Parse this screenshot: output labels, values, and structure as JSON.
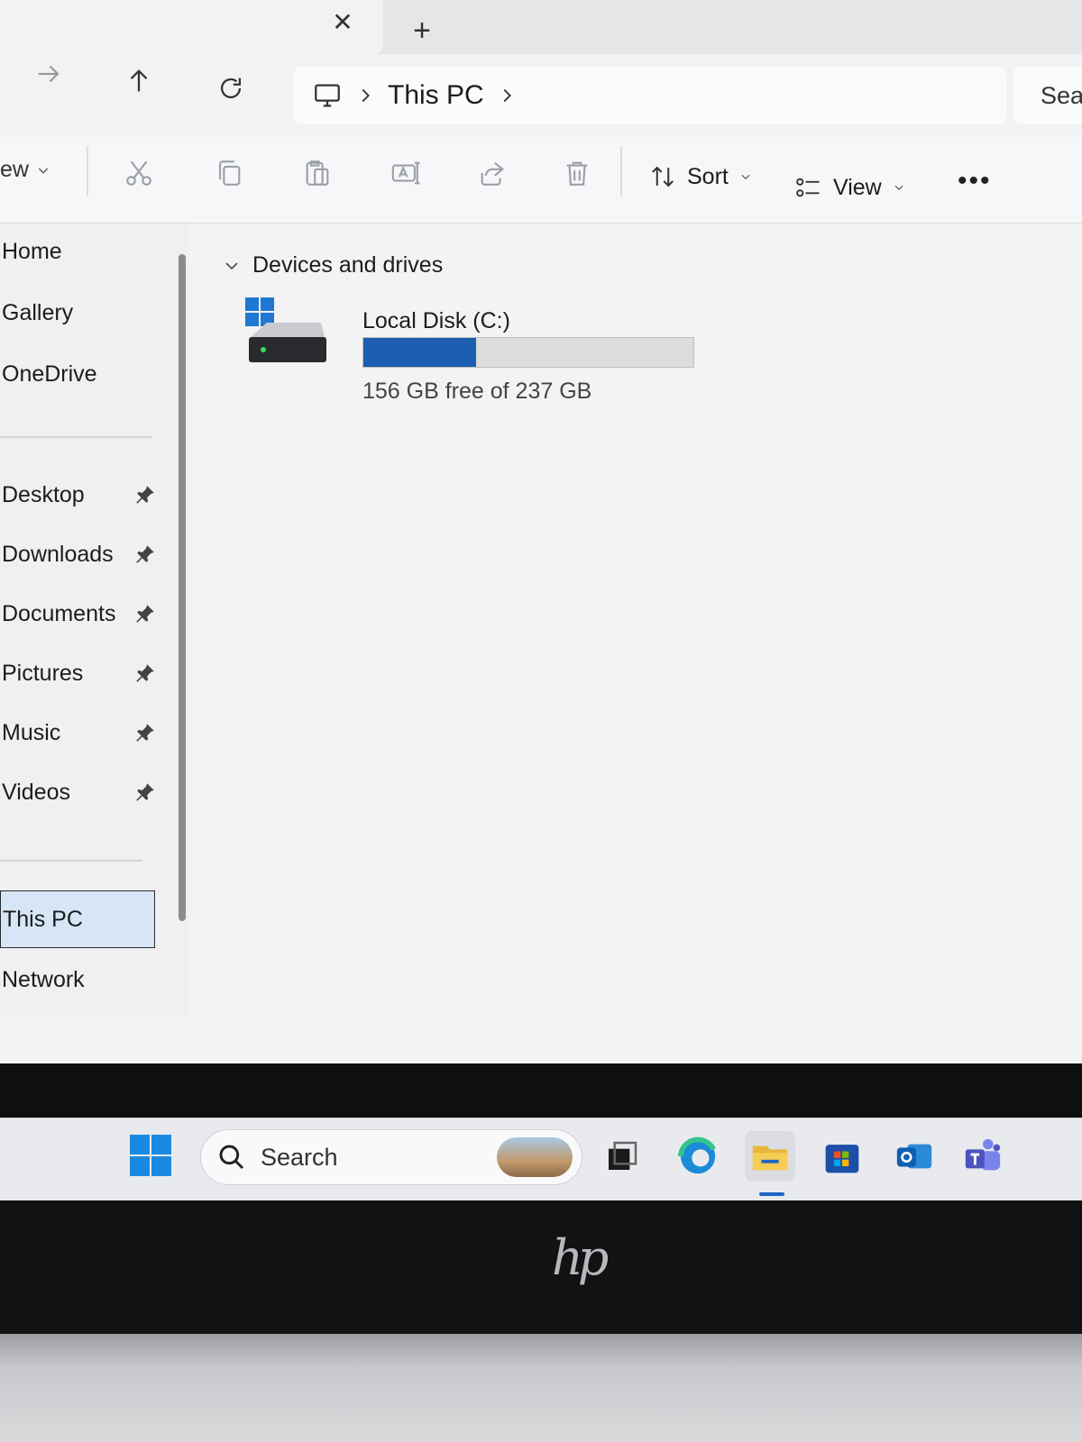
{
  "window": {
    "tab_close_glyph": "✕",
    "tab_new_glyph": "+"
  },
  "navigation": {
    "forward_icon": "arrow-right-icon",
    "up_icon": "arrow-up-icon",
    "refresh_icon": "refresh-icon",
    "breadcrumb": [
      "This PC"
    ],
    "search_placeholder": "Sear"
  },
  "toolbar": {
    "new_label": "ew",
    "sort_label": "Sort",
    "view_label": "View",
    "more_label": "•••",
    "icons": [
      "cut-icon",
      "copy-icon",
      "paste-icon",
      "rename-icon",
      "share-icon",
      "delete-icon"
    ]
  },
  "sidebar": {
    "top_items": [
      {
        "label": "Home"
      },
      {
        "label": "Gallery"
      },
      {
        "label": "OneDrive"
      }
    ],
    "pinned_items": [
      {
        "label": "Desktop",
        "pinned": true
      },
      {
        "label": "Downloads",
        "pinned": true
      },
      {
        "label": "Documents",
        "pinned": true
      },
      {
        "label": "Pictures",
        "pinned": true
      },
      {
        "label": "Music",
        "pinned": true
      },
      {
        "label": "Videos",
        "pinned": true
      }
    ],
    "bottom_items": [
      {
        "label": "This PC",
        "selected": true
      },
      {
        "label": "Network"
      }
    ]
  },
  "content": {
    "group_title": "Devices and drives",
    "drives": [
      {
        "name": "Local Disk (C:)",
        "free_text": "156 GB free of 237 GB",
        "used_fraction": 0.342
      }
    ]
  },
  "taskbar": {
    "search_label": "Search",
    "apps": [
      "task-view-icon",
      "edge-icon",
      "file-explorer-icon",
      "store-icon",
      "outlook-icon",
      "teams-icon"
    ],
    "active_app": "file-explorer-icon"
  },
  "device": {
    "logo_text": "hp"
  },
  "colors": {
    "accent": "#1c5fb0",
    "selection": "#d7e6f6"
  }
}
